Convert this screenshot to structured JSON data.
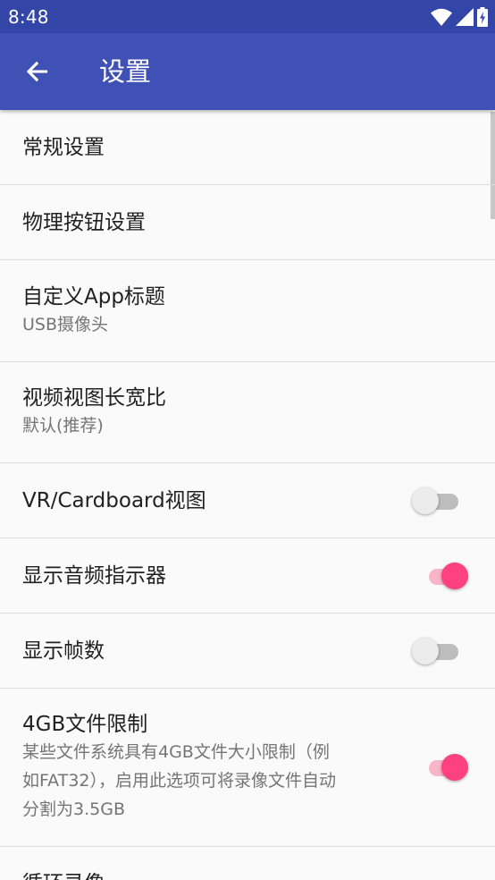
{
  "status_bar": {
    "time": "8:48",
    "icons": [
      "wifi-icon",
      "signal-icon",
      "battery-charging-icon"
    ]
  },
  "app_bar": {
    "back_icon": "arrow-left-icon",
    "title": "设置"
  },
  "colors": {
    "status_bar": "#3445a8",
    "app_bar": "#3f51b5",
    "accent": "#ff4081",
    "accent_track": "#f8b5c8"
  },
  "preferences": [
    {
      "title": "常规设置"
    },
    {
      "title": "物理按钮设置"
    },
    {
      "title": "自定义App标题",
      "summary": "USB摄像头"
    },
    {
      "title": "视频视图长宽比",
      "summary": "默认(推荐)"
    },
    {
      "title": "VR/Cardboard视图",
      "switch_on": false
    },
    {
      "title": "显示音频指示器",
      "switch_on": true
    },
    {
      "title": "显示帧数",
      "switch_on": false
    },
    {
      "title": "4GB文件限制",
      "summary_lines": [
        "某些文件系统具有4GB文件大小限制（例",
        "如FAT32），启用此选项可将录像文件自动",
        "分割为3.5GB"
      ],
      "switch_on": true
    },
    {
      "title": "循环录像"
    }
  ]
}
